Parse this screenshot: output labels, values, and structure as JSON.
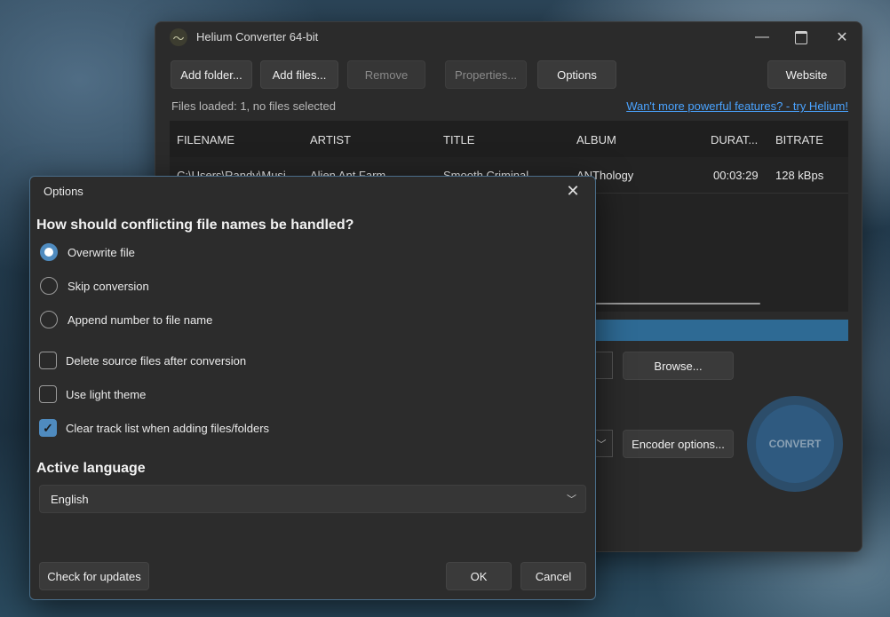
{
  "main_window": {
    "title": "Helium Converter 64-bit",
    "icon": "app-logo-icon",
    "toolbar": {
      "add_folder": "Add folder...",
      "add_files": "Add files...",
      "remove": "Remove",
      "properties": "Properties...",
      "options": "Options",
      "website": "Website"
    },
    "status": "Files loaded: 1, no files selected",
    "promo_link": "Wan't more powerful features? - try Helium!",
    "table": {
      "columns": [
        "FILENAME",
        "ARTIST",
        "TITLE",
        "ALBUM",
        "DURAT...",
        "BITRATE"
      ],
      "rows": [
        [
          "C:\\Users\\Randy\\Musi",
          "Alien Ant Farm",
          "Smooth Criminal",
          "ANThology",
          "00:03:29",
          "128 kBps"
        ]
      ]
    },
    "browse": "Browse...",
    "encoder_options": "Encoder options...",
    "convert": "CONVERT"
  },
  "options_dialog": {
    "title": "Options",
    "conflict_heading": "How should conflicting file names be handled?",
    "radio_options": [
      "Overwrite file",
      "Skip conversion",
      "Append number to file name"
    ],
    "selected_radio": "Overwrite file",
    "checkboxes": [
      {
        "label": "Delete source files after conversion",
        "checked": false
      },
      {
        "label": "Use light theme",
        "checked": false
      },
      {
        "label": "Clear track list when adding files/folders",
        "checked": true
      }
    ],
    "language_heading": "Active language",
    "language_value": "English",
    "check_updates": "Check for updates",
    "ok": "OK",
    "cancel": "Cancel"
  },
  "colors": {
    "accent": "#4f8bbf",
    "progress": "#2e6a94",
    "link": "#4aa3ff"
  }
}
